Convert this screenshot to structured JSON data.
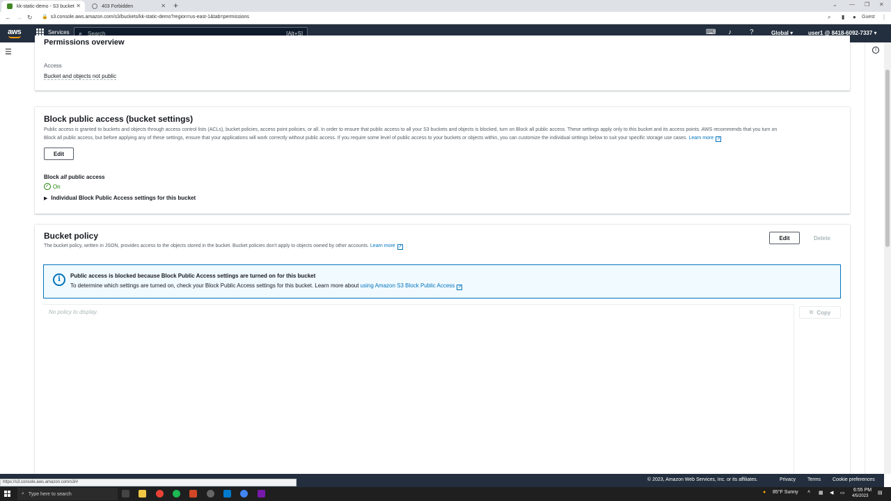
{
  "browser": {
    "tabs": [
      {
        "title": "kk-static-demo - S3 bucket",
        "active": true
      },
      {
        "title": "403 Forbidden",
        "active": false
      }
    ],
    "url": "s3.console.aws.amazon.com/s3/buckets/kk-static-demo?region=us-east-1&tab=permissions",
    "profile": "Guest",
    "status_url": "https://s3.console.aws.amazon.com/s3/#"
  },
  "awsnav": {
    "logo": "aws",
    "services": "Services",
    "search_placeholder": "Search",
    "search_shortcut": "[Alt+S]",
    "region": "Global",
    "account": "user1 @ 8418-6092-7337"
  },
  "permissions_overview": {
    "title": "Permissions overview",
    "access_label": "Access",
    "access_value": "Bucket and objects not public"
  },
  "block_public_access": {
    "title": "Block public access (bucket settings)",
    "description_line1": "Public access is granted to buckets and objects through access control lists (ACLs), bucket policies, access point policies, or all. In order to ensure that public access to all your S3 buckets and objects is blocked, turn on Block all public access. These settings apply only to this bucket and its access points. AWS recommends that you turn on",
    "description_line2": "Block all public access, but before applying any of these settings, ensure that your applications will work correctly without public access. If you require some level of public access to your buckets or objects within, you can customize the individual settings below to suit your specific storage use cases.",
    "learn_more": "Learn more",
    "edit_label": "Edit",
    "setting_label_prefix": "Block ",
    "setting_label_em": "all",
    "setting_label_suffix": " public access",
    "status": "On",
    "expand_label": "Individual Block Public Access settings for this bucket"
  },
  "bucket_policy": {
    "title": "Bucket policy",
    "description": "The bucket policy, written in JSON, provides access to the objects stored in the bucket. Bucket policies don't apply to objects owned by other accounts.",
    "learn_more": "Learn more",
    "edit_label": "Edit",
    "delete_label": "Delete",
    "alert_title": "Public access is blocked because Block Public Access settings are turned on for this bucket",
    "alert_body": "To determine which settings are turned on, check your Block Public Access settings for this bucket. Learn more about",
    "alert_link": "using Amazon S3 Block Public Access",
    "no_policy": "No policy to display.",
    "copy_label": "Copy"
  },
  "footer": {
    "copyright": "© 2023, Amazon Web Services, Inc. or its affiliates.",
    "privacy": "Privacy",
    "terms": "Terms",
    "cookies": "Cookie preferences"
  },
  "taskbar": {
    "search_placeholder": "Type here to search",
    "weather": "85°F  Sunny",
    "time": "6:55 PM",
    "date": "4/5/2023"
  },
  "colors": {
    "aws_nav": "#232f3e",
    "link": "#0073bb",
    "success": "#1d8102",
    "orange": "#ff9900"
  }
}
